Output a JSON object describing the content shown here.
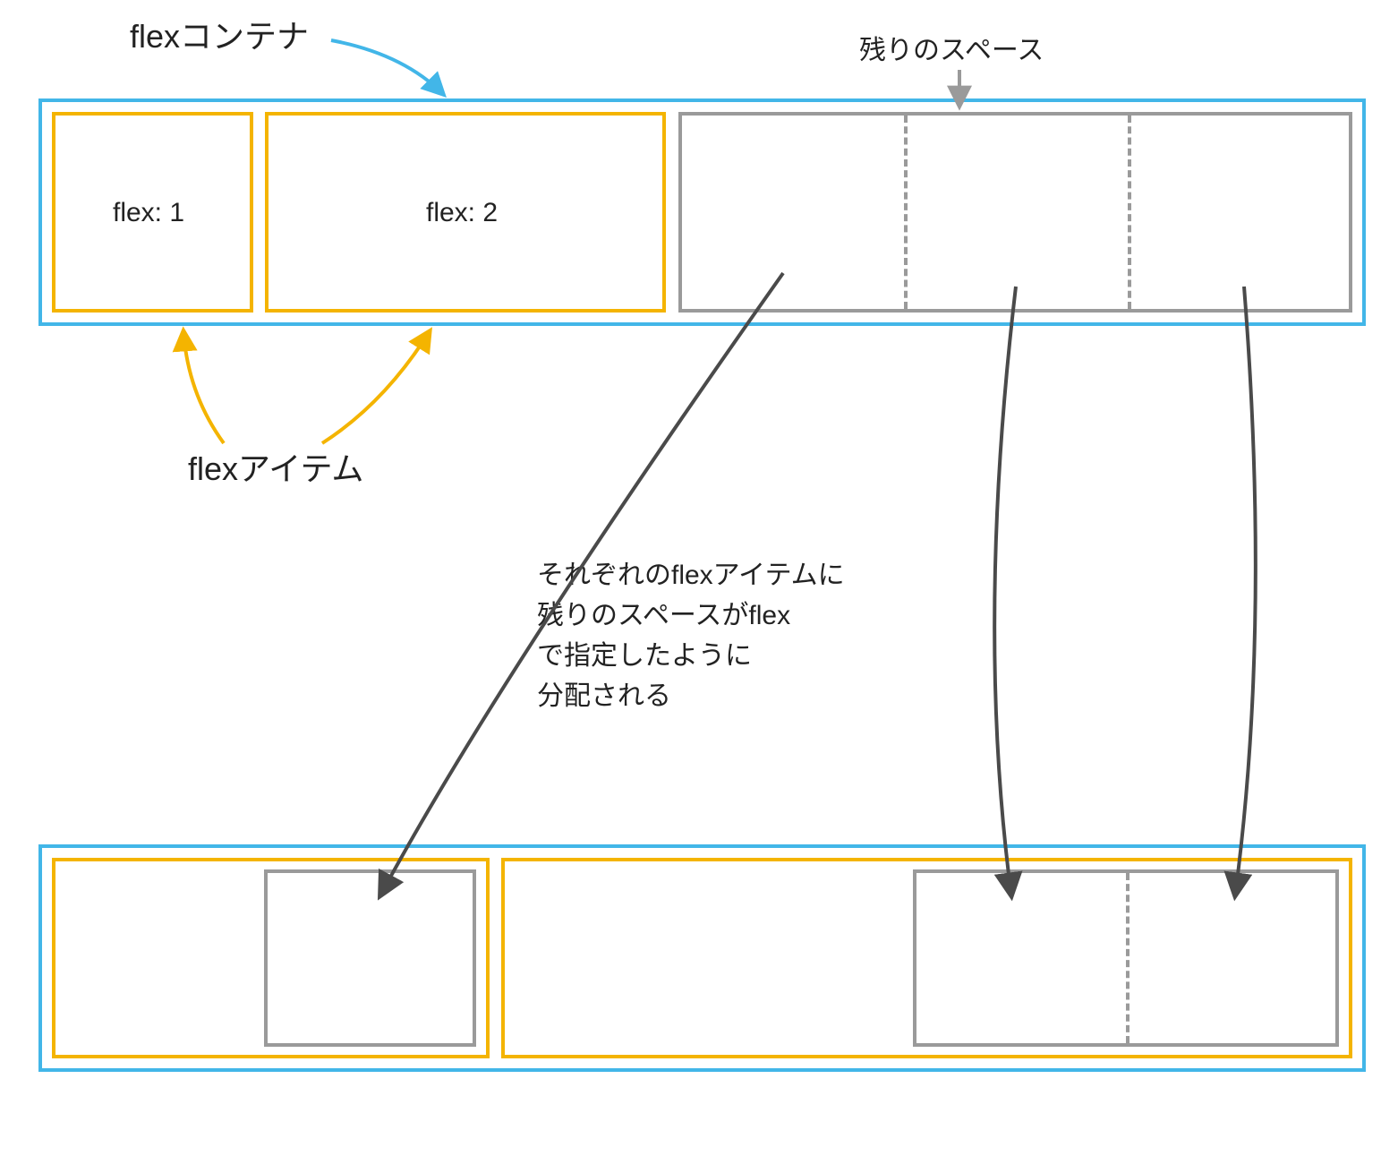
{
  "labels": {
    "flex_container": "flexコンテナ",
    "remaining_space": "残りのスペース",
    "flex_items": "flexアイテム",
    "explanation": "それぞれのflexアイテムに\n残りのスペースがflex\nで指定したように\n分配される"
  },
  "items": {
    "flex1": "flex: 1",
    "flex2": "flex: 2"
  },
  "colors": {
    "container_border": "#42b6e8",
    "item_border": "#f4b400",
    "grey": "#9a9a9a",
    "arrow_dark": "#4a4a4a"
  }
}
